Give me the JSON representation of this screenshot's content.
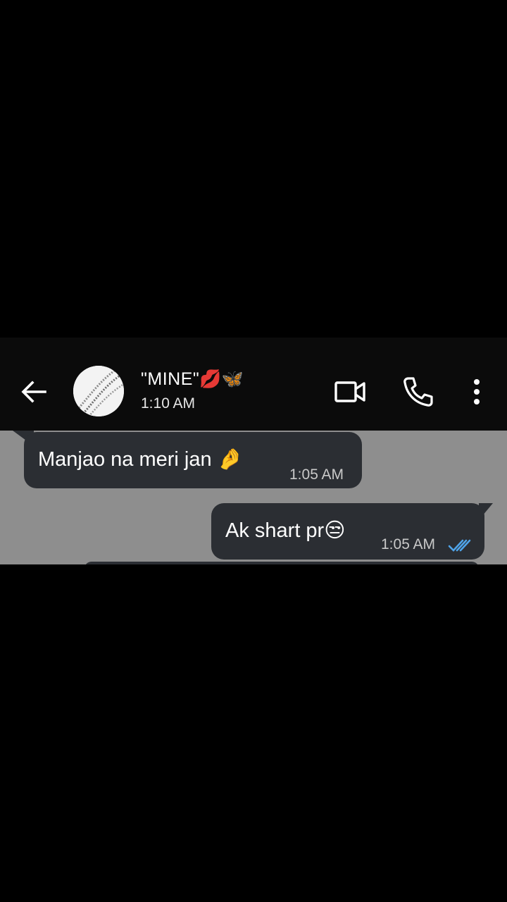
{
  "header": {
    "contact_name": "\"MINE\"",
    "contact_emojis": "💋🦋",
    "status": "1:10 AM",
    "icons": {
      "back": "arrow-left-icon",
      "video": "video-camera-icon",
      "call": "phone-icon",
      "more": "more-vertical-icon"
    }
  },
  "messages": [
    {
      "direction": "incoming",
      "text": "Manjao na meri jan",
      "emoji": "🤌",
      "time": "1:05 AM"
    },
    {
      "direction": "outgoing",
      "text": "Ak shart pr",
      "emoji": "😒",
      "time": "1:05 AM",
      "read_receipt": "double-check-icon",
      "read_receipt_color": "#4fa3e8"
    }
  ],
  "colors": {
    "header_bg": "#0b0b0b",
    "chat_bg": "#8e8e8e",
    "bubble_bg": "#2b2e33",
    "page_bg": "#000000"
  }
}
